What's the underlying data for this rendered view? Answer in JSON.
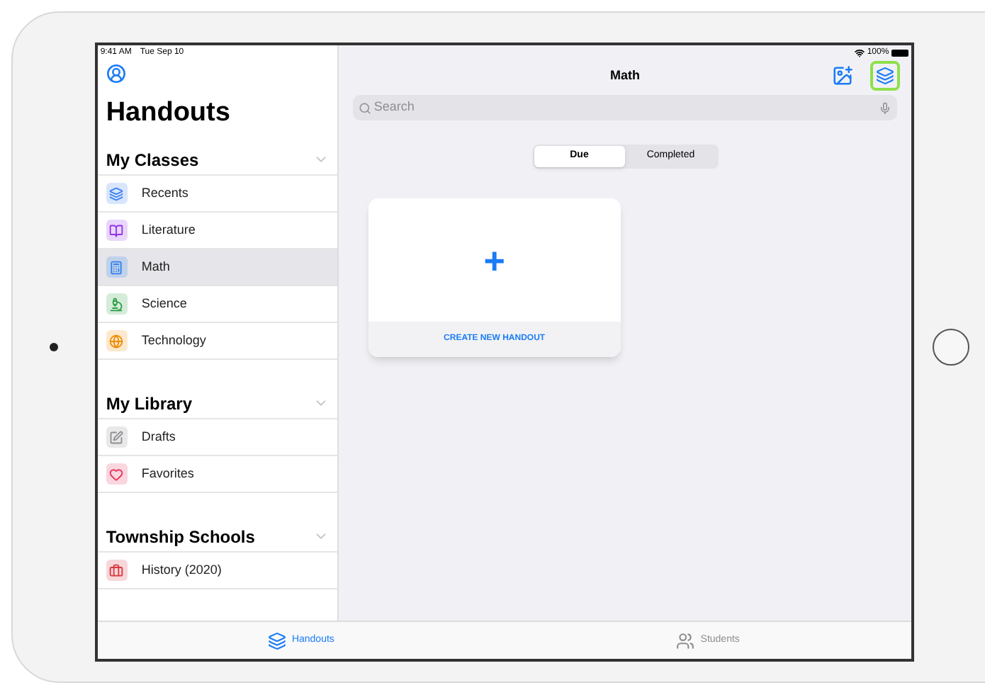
{
  "status_bar": {
    "time": "9:41 AM",
    "date": "Tue Sep 10",
    "battery": "100%"
  },
  "sidebar": {
    "title": "Handouts",
    "sections": [
      {
        "title": "My Classes",
        "items": [
          {
            "label": "Recents",
            "selected": false,
            "color": "#3b82f6"
          },
          {
            "label": "Literature",
            "selected": false,
            "color": "#9333ea"
          },
          {
            "label": "Math",
            "selected": true,
            "color": "#2f80ed"
          },
          {
            "label": "Science",
            "selected": false,
            "color": "#2f9e44"
          },
          {
            "label": "Technology",
            "selected": false,
            "color": "#f08c00"
          }
        ]
      },
      {
        "title": "My Library",
        "items": [
          {
            "label": "Drafts",
            "selected": false,
            "color": "#8e8e93"
          },
          {
            "label": "Favorites",
            "selected": false,
            "color": "#e8335a"
          }
        ]
      },
      {
        "title": "Township Schools",
        "items": [
          {
            "label": "History (2020)",
            "selected": false,
            "color": "#d9383f"
          }
        ]
      }
    ]
  },
  "main": {
    "title": "Math",
    "search": {
      "placeholder": "Search"
    },
    "segments": [
      {
        "label": "Due",
        "selected": true
      },
      {
        "label": "Completed",
        "selected": false
      }
    ],
    "card": {
      "symbol": "+",
      "action": "CREATE NEW HANDOUT"
    }
  },
  "tab_bar": [
    {
      "label": "Handouts",
      "selected": true
    },
    {
      "label": "Students",
      "selected": false
    }
  ]
}
